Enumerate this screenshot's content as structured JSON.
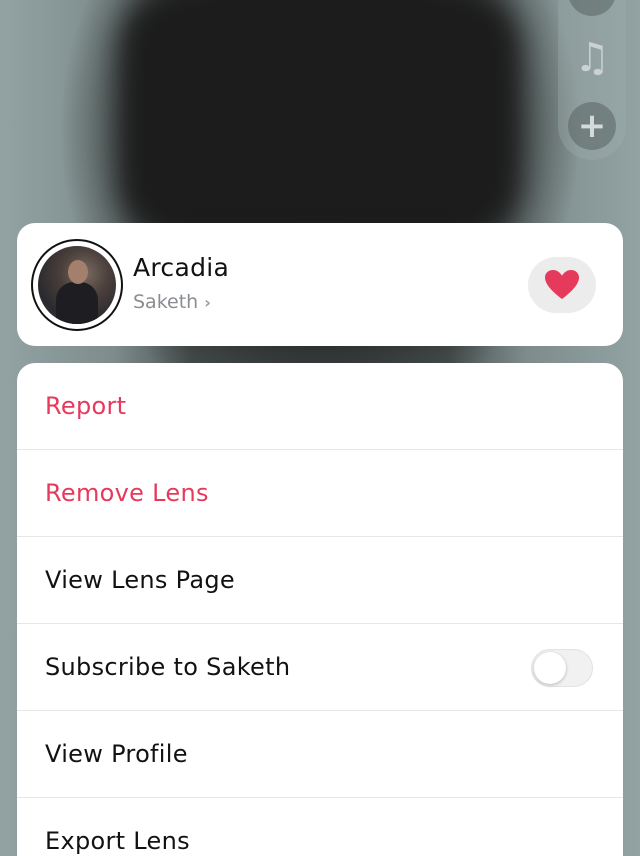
{
  "lens": {
    "name": "Arcadia",
    "creator": "Saketh",
    "creator_chevron": "›",
    "favorited": true
  },
  "side_rail": {
    "music_glyph": "♫",
    "add_glyph": "+"
  },
  "menu": {
    "report": "Report",
    "remove_lens": "Remove Lens",
    "view_lens_page": "View Lens Page",
    "subscribe": "Subscribe to Saketh",
    "subscribe_enabled": false,
    "view_profile": "View Profile",
    "export_lens": "Export Lens"
  },
  "colors": {
    "danger": "#e63a5c",
    "heart": "#e63a5c"
  }
}
